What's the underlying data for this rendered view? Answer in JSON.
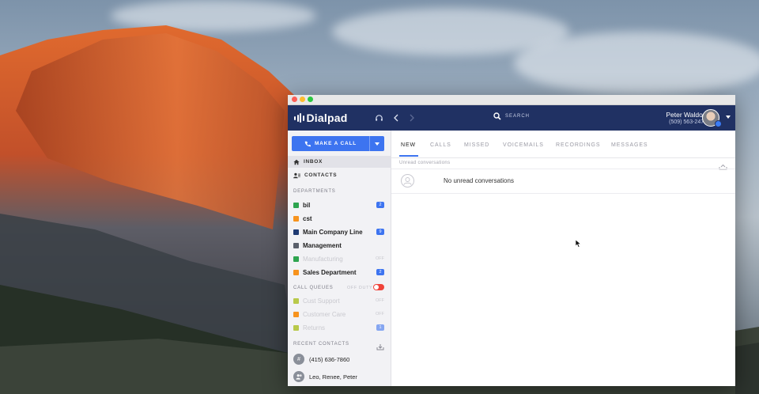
{
  "app": {
    "brand": "Dialpad",
    "search_label": "SEARCH"
  },
  "user": {
    "name": "Peter Waldorf",
    "phone": "(509) 563-2478"
  },
  "sidebar": {
    "make_call_label": "MAKE A CALL",
    "nav": [
      {
        "label": "INBOX",
        "icon": "home-icon",
        "active": true
      },
      {
        "label": "CONTACTS",
        "icon": "contacts-icon",
        "active": false
      }
    ],
    "departments_label": "DEPARTMENTS",
    "departments": [
      {
        "name": "bil",
        "color": "#2ea44f",
        "badge": "2",
        "muted": false
      },
      {
        "name": "cst",
        "color": "#f7931e",
        "badge": "",
        "muted": false
      },
      {
        "name": "Main Company Line",
        "color": "#1f3b73",
        "badge": "9",
        "muted": false
      },
      {
        "name": "Management",
        "color": "#5a5f6b",
        "badge": "",
        "muted": false
      },
      {
        "name": "Manufacturing",
        "color": "#2ea44f",
        "badge": "OFF",
        "muted": true
      },
      {
        "name": "Sales Department",
        "color": "#f7931e",
        "badge": "2",
        "muted": false
      }
    ],
    "call_queues_label": "CALL QUEUES",
    "off_duty_label": "OFF DUTY",
    "queues": [
      {
        "name": "Cust Support",
        "color": "#b8c94a",
        "badge": "OFF",
        "muted": true
      },
      {
        "name": "Customer Care",
        "color": "#f7931e",
        "badge": "OFF",
        "muted": true
      },
      {
        "name": "Returns",
        "color": "#b8c94a",
        "badge": "1",
        "muted": true
      }
    ],
    "recent_contacts_label": "RECENT CONTACTS",
    "recent_contacts": [
      {
        "name": "(415) 636-7860",
        "avatar": "#"
      },
      {
        "name": "Leo, Renee, Peter",
        "avatar": "group-icon"
      }
    ]
  },
  "main": {
    "tabs": [
      "NEW",
      "CALLS",
      "MISSED",
      "VOICEMAILS",
      "RECORDINGS",
      "MESSAGES"
    ],
    "active_tab": "NEW",
    "sub_label": "Unread conversations",
    "empty_text": "No unread conversations"
  },
  "colors": {
    "header_bg": "#203163",
    "accent": "#3d74f0",
    "toggle_off": "#f0433a"
  }
}
